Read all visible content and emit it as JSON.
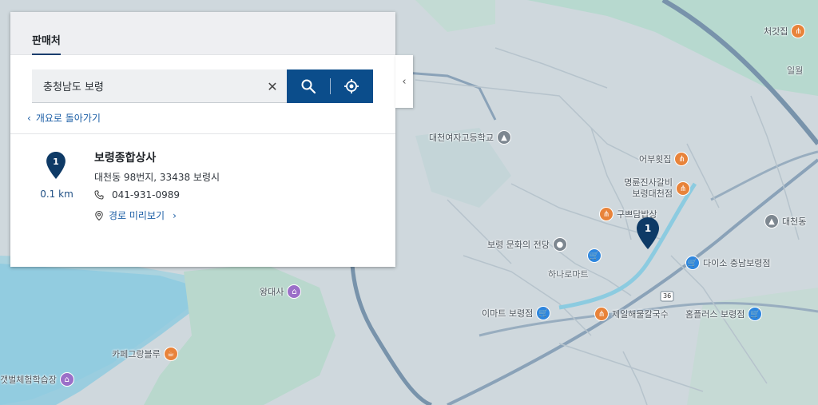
{
  "panel": {
    "tab_label": "판매처",
    "search": {
      "value": "충청남도 보령",
      "placeholder": ""
    },
    "back_link": "개요로 돌아가기",
    "result": {
      "number": "1",
      "distance": "0.1 km",
      "name": "보령종합상사",
      "address": "대천동 98번지, 33438 보령시",
      "phone": "041-931-0989",
      "route_label": "경로 미리보기"
    }
  },
  "map": {
    "marker_number": "1",
    "pois": [
      {
        "name": "대천여자고등학교",
        "icon": "school-icon",
        "type": "gray"
      },
      {
        "name": "어부횟집",
        "icon": "food-icon",
        "type": "food"
      },
      {
        "name": "명륜진사갈비 보령대천점",
        "icon": "food-icon",
        "type": "food"
      },
      {
        "name": "구쁘담밥상",
        "icon": "food-icon",
        "type": "food"
      },
      {
        "name": "보령 문화의 전당",
        "icon": "venue-icon",
        "type": "gray"
      },
      {
        "name": "하나로마트",
        "icon": "shop-icon",
        "type": "shop"
      },
      {
        "name": "다이소 충남보령점",
        "icon": "shop-icon",
        "type": "shop"
      },
      {
        "name": "이마트 보령점",
        "icon": "shop-icon",
        "type": "shop"
      },
      {
        "name": "제일해물칼국수",
        "icon": "food-icon",
        "type": "food"
      },
      {
        "name": "홈플러스 보령점",
        "icon": "shop-icon",
        "type": "shop"
      },
      {
        "name": "대천동",
        "icon": "school-icon",
        "type": "gray"
      },
      {
        "name": "처갓집",
        "icon": "food-icon",
        "type": "food"
      },
      {
        "name": "왕대사",
        "icon": "temple-icon",
        "type": "purple"
      },
      {
        "name": "카페그랑블루",
        "icon": "cafe-icon",
        "type": "food"
      },
      {
        "name": "갯벌체험학습장",
        "icon": "experience-icon",
        "type": "purple"
      }
    ],
    "labels": [
      "일월",
      "대천동",
      "36"
    ]
  },
  "colors": {
    "accent": "#0b4d8b",
    "link": "#1d5fa6",
    "marker": "#0e3a66"
  }
}
